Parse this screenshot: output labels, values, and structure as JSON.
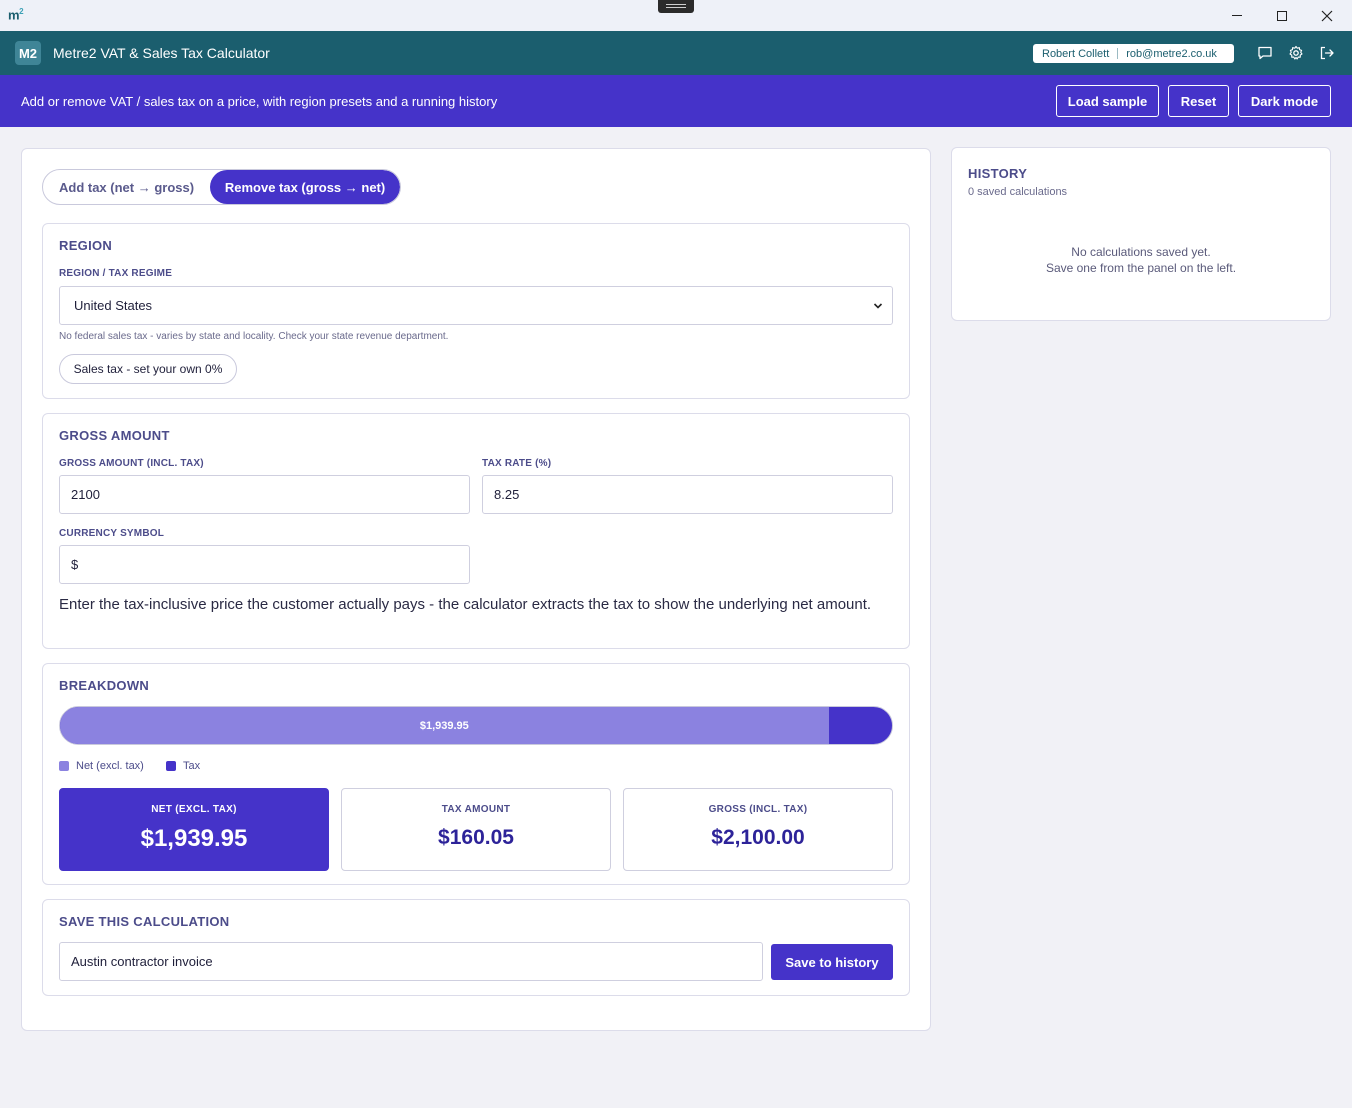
{
  "window": {
    "logo_text": "m",
    "logo_sup": "2"
  },
  "appbar": {
    "badge": "M2",
    "title": "Metre2 VAT & Sales Tax Calculator",
    "user_name": "Robert Collett",
    "user_email": "rob@metre2.co.uk",
    "icons": [
      "chat-icon",
      "settings-icon",
      "logout-icon"
    ]
  },
  "banner": {
    "text": "Add or remove VAT / sales tax on a price, with region presets and a running history",
    "load_sample": "Load sample",
    "reset": "Reset",
    "dark_mode": "Dark mode"
  },
  "mode": {
    "add_label": "Add tax (net → gross)",
    "remove_label": "Remove tax (gross → net)",
    "selected": "remove"
  },
  "region": {
    "section_title": "REGION",
    "field_label": "REGION / TAX REGIME",
    "selected": "United States",
    "hint": "No federal sales tax - varies by state and locality. Check your state revenue department.",
    "chip": "Sales tax - set your own 0%"
  },
  "gross": {
    "section_title": "GROSS AMOUNT",
    "amount_label": "GROSS AMOUNT (INCL. TAX)",
    "amount_value": "2100",
    "rate_label": "TAX RATE (%)",
    "rate_value": "8.25",
    "currency_label": "CURRENCY SYMBOL",
    "currency_value": "$",
    "description": "Enter the tax-inclusive price the customer actually pays - the calculator extracts the tax to show the underlying net amount."
  },
  "breakdown": {
    "section_title": "BREAKDOWN",
    "bar_label": "$1,939.95",
    "net_fraction": 0.9238,
    "legend_net": "Net (excl. tax)",
    "legend_tax": "Tax",
    "net_color": "#8b82e0",
    "tax_color": "#4533c9",
    "net_label": "NET (EXCL. TAX)",
    "net_value": "$1,939.95",
    "tax_label": "TAX AMOUNT",
    "tax_value": "$160.05",
    "gross_label": "GROSS (INCL. TAX)",
    "gross_value": "$2,100.00"
  },
  "save": {
    "section_title": "SAVE THIS CALCULATION",
    "name_value": "Austin contractor invoice",
    "button": "Save to history"
  },
  "history": {
    "title": "HISTORY",
    "count": "0 saved calculations",
    "empty_line1": "No calculations saved yet.",
    "empty_line2": "Save one from the panel on the left."
  },
  "colors": {
    "teal": "#1b5e6e",
    "accent": "#4533c9"
  }
}
